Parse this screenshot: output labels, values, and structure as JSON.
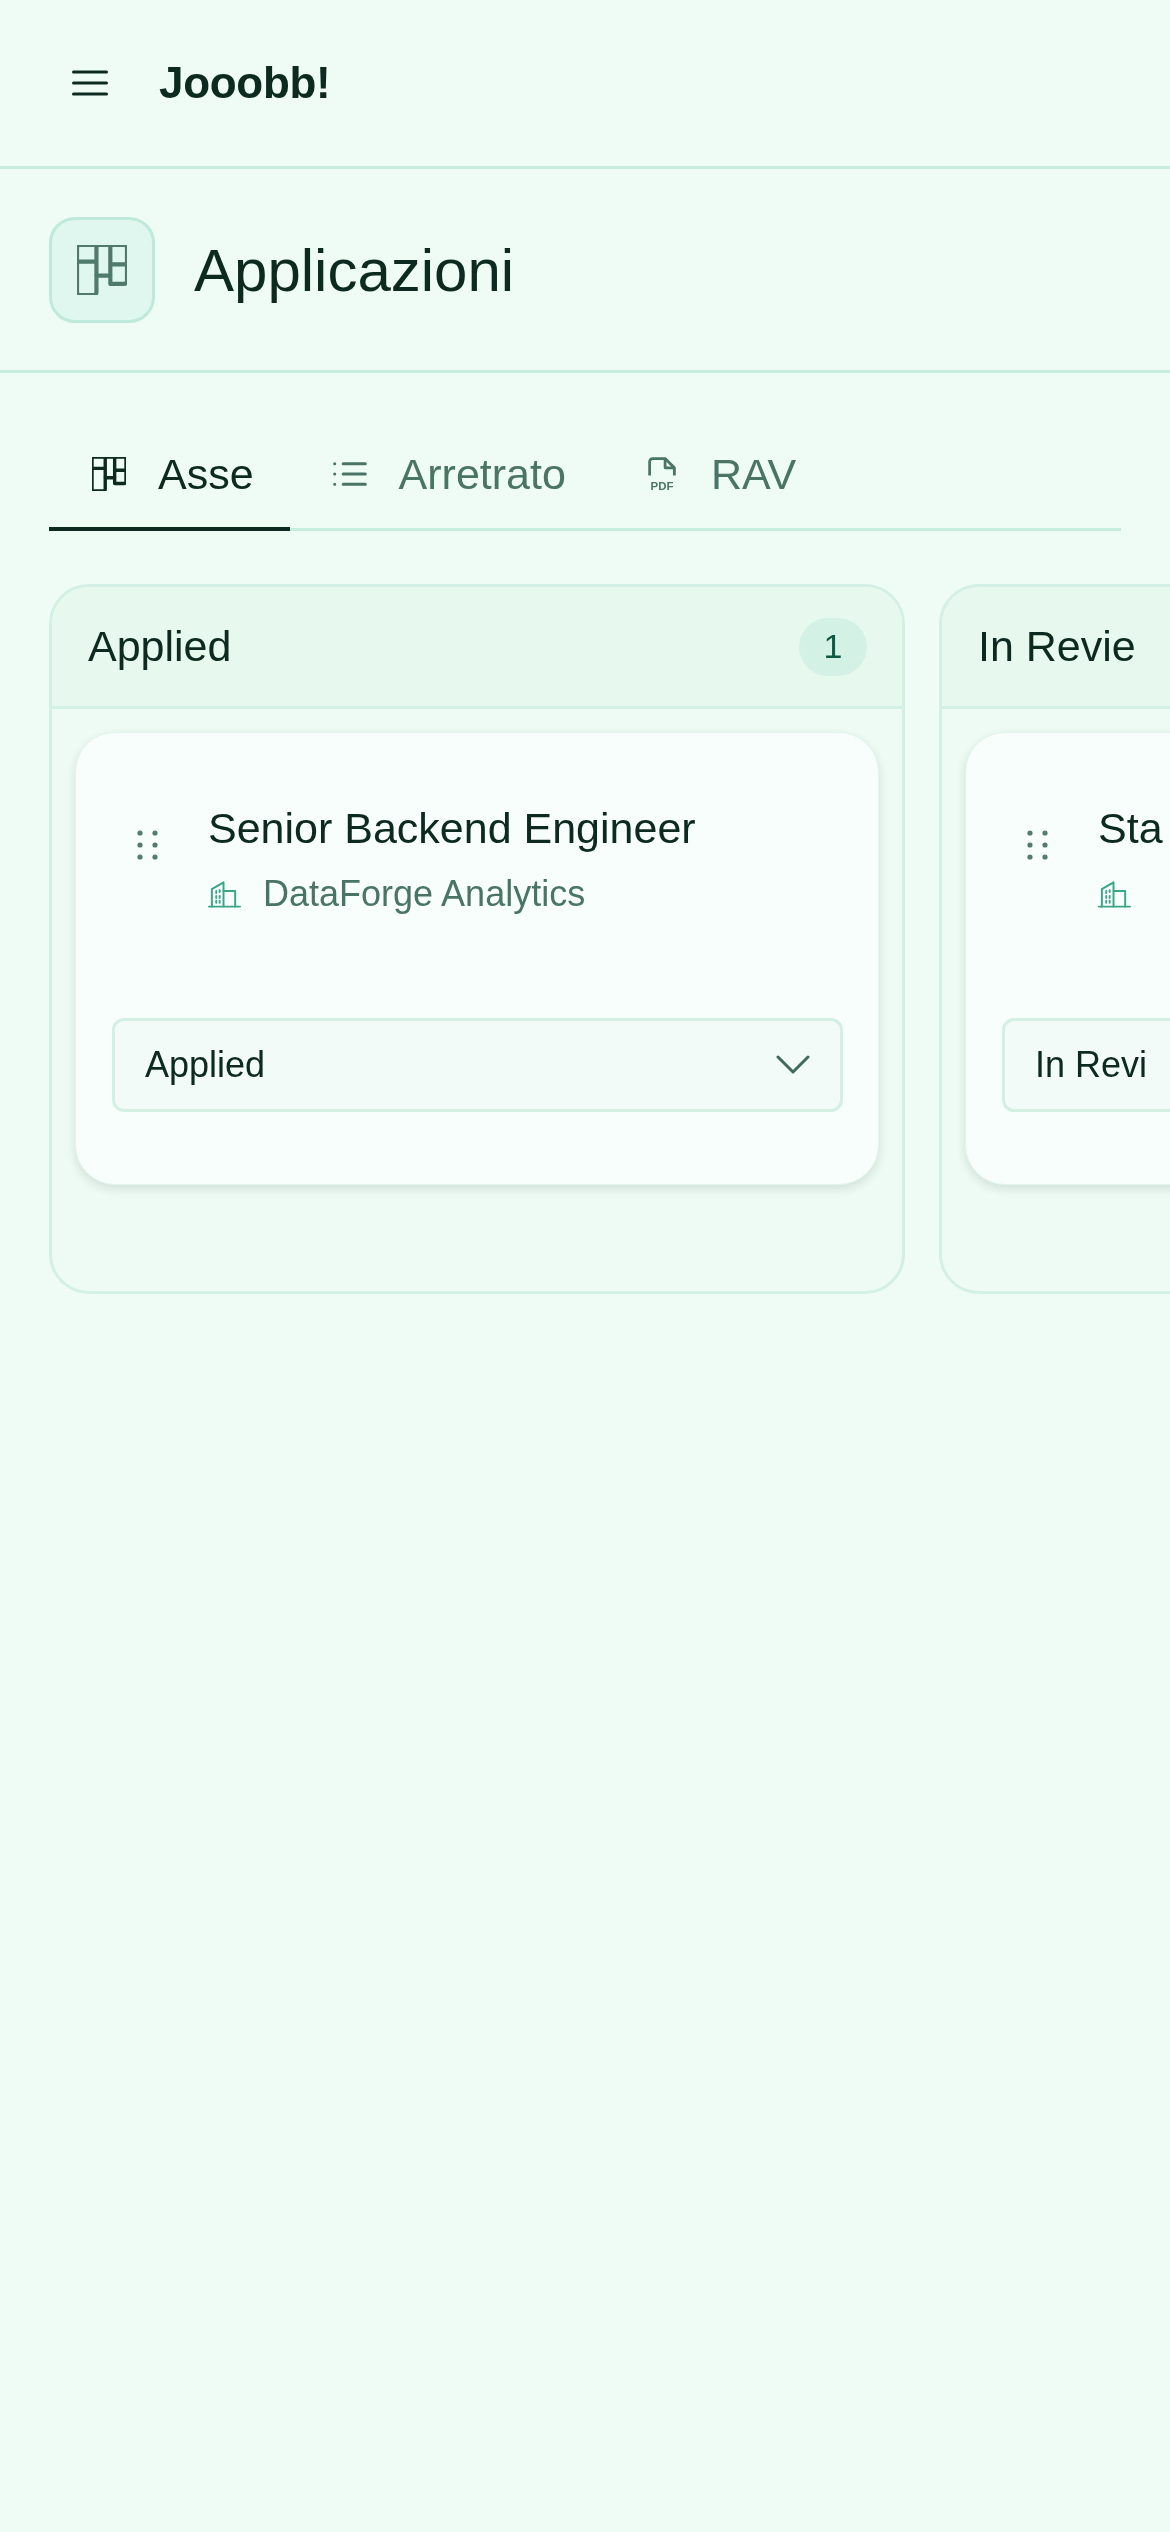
{
  "app_bar": {
    "title": "Jooobb!"
  },
  "page": {
    "title": "Applicazioni"
  },
  "tabs": [
    {
      "label": "Asse",
      "kind": "board",
      "selected": true
    },
    {
      "label": "Arretrato",
      "kind": "list",
      "selected": false
    },
    {
      "label": "RAV",
      "kind": "pdf",
      "icon_text": "PDF",
      "selected": false
    }
  ],
  "board": {
    "columns": [
      {
        "title": "Applied",
        "count": "1",
        "cards": [
          {
            "title": "Senior Backend Engineer",
            "company": "DataForge Analytics",
            "status": "Applied"
          }
        ]
      },
      {
        "title": "In Revie",
        "cards": [
          {
            "title": "Sta",
            "status": "In Revi"
          }
        ]
      }
    ]
  }
}
